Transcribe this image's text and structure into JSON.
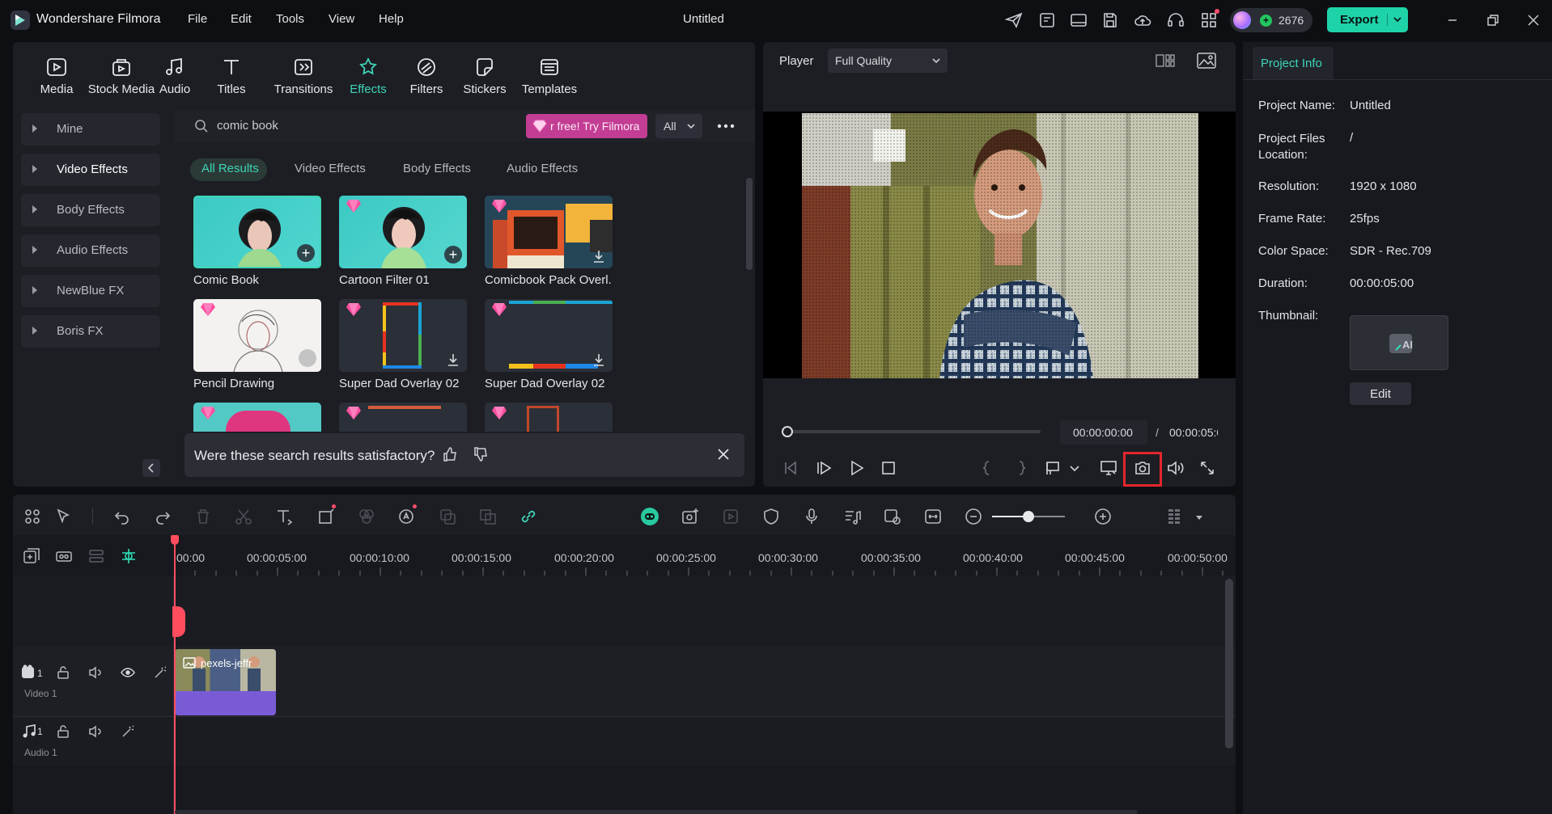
{
  "app": {
    "title": "Wondershare Filmora",
    "document_title": "Untitled",
    "menu": [
      "File",
      "Edit",
      "Tools",
      "View",
      "Help"
    ],
    "credits": "2676",
    "export_label": "Export",
    "accent": "#1ee0b4"
  },
  "media_toolbar": {
    "items": [
      {
        "label": "Media",
        "icon": "media-icon"
      },
      {
        "label": "Stock Media",
        "icon": "stock-media-icon"
      },
      {
        "label": "Audio",
        "icon": "audio-icon"
      },
      {
        "label": "Titles",
        "icon": "titles-icon"
      },
      {
        "label": "Transitions",
        "icon": "transitions-icon"
      },
      {
        "label": "Effects",
        "icon": "effects-icon",
        "active": true
      },
      {
        "label": "Filters",
        "icon": "filters-icon"
      },
      {
        "label": "Stickers",
        "icon": "stickers-icon"
      },
      {
        "label": "Templates",
        "icon": "templates-icon"
      }
    ]
  },
  "sidebar": {
    "items": [
      {
        "label": "Mine"
      },
      {
        "label": "Video Effects",
        "selected": true
      },
      {
        "label": "Body Effects"
      },
      {
        "label": "Audio Effects"
      },
      {
        "label": "NewBlue FX"
      },
      {
        "label": "Boris FX"
      }
    ]
  },
  "search": {
    "value": "comic book",
    "promo": "r free! Try Filmora",
    "filter": "All"
  },
  "filter_tabs": [
    "All Results",
    "Video Effects",
    "Body Effects",
    "Audio Effects"
  ],
  "effects": [
    {
      "title": "Comic Book",
      "premium": false,
      "action": "add"
    },
    {
      "title": "Cartoon Filter 01",
      "premium": true,
      "action": "add"
    },
    {
      "title": "Comicbook Pack Overl...",
      "premium": true,
      "action": "download"
    },
    {
      "title": "Pencil Drawing",
      "premium": true,
      "action": "download"
    },
    {
      "title": "Super Dad Overlay 02",
      "premium": true,
      "action": "download"
    },
    {
      "title": "Super Dad Overlay 02",
      "premium": true,
      "action": "download"
    }
  ],
  "feedback": {
    "question": "Were these search results satisfactory?"
  },
  "player": {
    "label": "Player",
    "quality": "Full Quality",
    "current_time": "00:00:00:00",
    "separator": "/",
    "total_time": "00:00:05:0("
  },
  "project_info": {
    "tab": "Project Info",
    "fields": [
      {
        "label": "Project Name:",
        "value": "Untitled"
      },
      {
        "label": "Project Files Location:",
        "value": "/"
      },
      {
        "label": "Resolution:",
        "value": "1920 x 1080"
      },
      {
        "label": "Frame Rate:",
        "value": "25fps"
      },
      {
        "label": "Color Space:",
        "value": "SDR - Rec.709"
      },
      {
        "label": "Duration:",
        "value": "00:00:05:00"
      }
    ],
    "thumbnail_label": "Thumbnail:",
    "edit_label": "Edit"
  },
  "timeline": {
    "ruler": [
      "00:00",
      "00:00:05:00",
      "00:00:10:00",
      "00:00:15:00",
      "00:00:20:00",
      "00:00:25:00",
      "00:00:30:00",
      "00:00:35:00",
      "00:00:40:00",
      "00:00:45:00",
      "00:00:50:00"
    ],
    "tracks": [
      {
        "name": "Video 1",
        "index": "1"
      },
      {
        "name": "Audio 1",
        "index": "1"
      }
    ],
    "clip_label": "pexels-jeffr",
    "zoom_level": 0.5
  }
}
